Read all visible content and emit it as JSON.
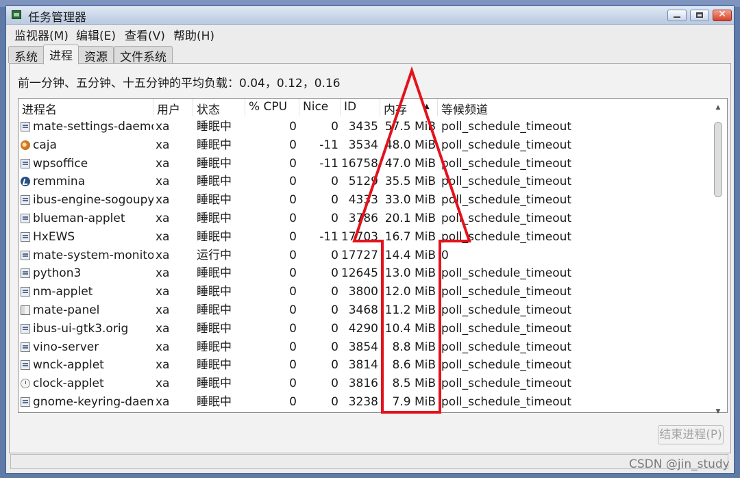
{
  "window": {
    "title": "任务管理器"
  },
  "menu": [
    "监视器(M)",
    "编辑(E)",
    "查看(V)",
    "帮助(H)"
  ],
  "tabs": [
    "系统",
    "进程",
    "资源",
    "文件系统"
  ],
  "active_tab": "进程",
  "load_text": "前一分钟、五分钟、十五分钟的平均负载：0.04，0.12，0.16",
  "columns": [
    "进程名",
    "用户",
    "状态",
    "% CPU",
    "Nice",
    "ID",
    "内存",
    "等候频道"
  ],
  "sorted_column": "内存",
  "processes": [
    {
      "name": "mate-settings-daemon",
      "icon": "app-icon",
      "user": "xa",
      "state": "睡眠中",
      "cpu": "0",
      "nice": "0",
      "id": "3435",
      "mem": "57.5 MiB",
      "wait": "poll_schedule_timeout"
    },
    {
      "name": "caja",
      "icon": "caja-icon",
      "user": "xa",
      "state": "睡眠中",
      "cpu": "0",
      "nice": "-11",
      "id": "3534",
      "mem": "48.0 MiB",
      "wait": "poll_schedule_timeout"
    },
    {
      "name": "wpsoffice",
      "icon": "app-icon",
      "user": "xa",
      "state": "睡眠中",
      "cpu": "0",
      "nice": "-11",
      "id": "16758",
      "mem": "47.0 MiB",
      "wait": "poll_schedule_timeout"
    },
    {
      "name": "remmina",
      "icon": "remmina-icon",
      "user": "xa",
      "state": "睡眠中",
      "cpu": "0",
      "nice": "0",
      "id": "5129",
      "mem": "35.5 MiB",
      "wait": "poll_schedule_timeout"
    },
    {
      "name": "ibus-engine-sogoupy",
      "icon": "app-icon",
      "user": "xa",
      "state": "睡眠中",
      "cpu": "0",
      "nice": "0",
      "id": "4333",
      "mem": "33.0 MiB",
      "wait": "poll_schedule_timeout"
    },
    {
      "name": "blueman-applet",
      "icon": "app-icon",
      "user": "xa",
      "state": "睡眠中",
      "cpu": "0",
      "nice": "0",
      "id": "3786",
      "mem": "20.1 MiB",
      "wait": "poll_schedule_timeout"
    },
    {
      "name": "HxEWS",
      "icon": "app-icon",
      "user": "xa",
      "state": "睡眠中",
      "cpu": "0",
      "nice": "-11",
      "id": "17703",
      "mem": "16.7 MiB",
      "wait": "poll_schedule_timeout"
    },
    {
      "name": "mate-system-monitor",
      "icon": "app-icon",
      "user": "xa",
      "state": "运行中",
      "cpu": "0",
      "nice": "0",
      "id": "17727",
      "mem": "14.4 MiB",
      "wait": "0"
    },
    {
      "name": "python3",
      "icon": "app-icon",
      "user": "xa",
      "state": "睡眠中",
      "cpu": "0",
      "nice": "0",
      "id": "12645",
      "mem": "13.0 MiB",
      "wait": "poll_schedule_timeout"
    },
    {
      "name": "nm-applet",
      "icon": "app-icon",
      "user": "xa",
      "state": "睡眠中",
      "cpu": "0",
      "nice": "0",
      "id": "3800",
      "mem": "12.0 MiB",
      "wait": "poll_schedule_timeout"
    },
    {
      "name": "mate-panel",
      "icon": "panel-icon",
      "user": "xa",
      "state": "睡眠中",
      "cpu": "0",
      "nice": "0",
      "id": "3468",
      "mem": "11.2 MiB",
      "wait": "poll_schedule_timeout"
    },
    {
      "name": "ibus-ui-gtk3.orig",
      "icon": "app-icon",
      "user": "xa",
      "state": "睡眠中",
      "cpu": "0",
      "nice": "0",
      "id": "4290",
      "mem": "10.4 MiB",
      "wait": "poll_schedule_timeout"
    },
    {
      "name": "vino-server",
      "icon": "app-icon",
      "user": "xa",
      "state": "睡眠中",
      "cpu": "0",
      "nice": "0",
      "id": "3854",
      "mem": "8.8 MiB",
      "wait": "poll_schedule_timeout"
    },
    {
      "name": "wnck-applet",
      "icon": "app-icon",
      "user": "xa",
      "state": "睡眠中",
      "cpu": "0",
      "nice": "0",
      "id": "3814",
      "mem": "8.6 MiB",
      "wait": "poll_schedule_timeout"
    },
    {
      "name": "clock-applet",
      "icon": "clock-icon",
      "user": "xa",
      "state": "睡眠中",
      "cpu": "0",
      "nice": "0",
      "id": "3816",
      "mem": "8.5 MiB",
      "wait": "poll_schedule_timeout"
    },
    {
      "name": "gnome-keyring-daemon",
      "icon": "app-icon",
      "user": "xa",
      "state": "睡眠中",
      "cpu": "0",
      "nice": "0",
      "id": "3238",
      "mem": "7.9 MiB",
      "wait": "poll_schedule_timeout"
    }
  ],
  "end_process_label": "结束进程(P)",
  "watermark": "CSDN @jin_study",
  "colors": {
    "annotation": "#e3121b",
    "titlebar": "#c3d1e6",
    "window_border": "#3c5d93"
  }
}
